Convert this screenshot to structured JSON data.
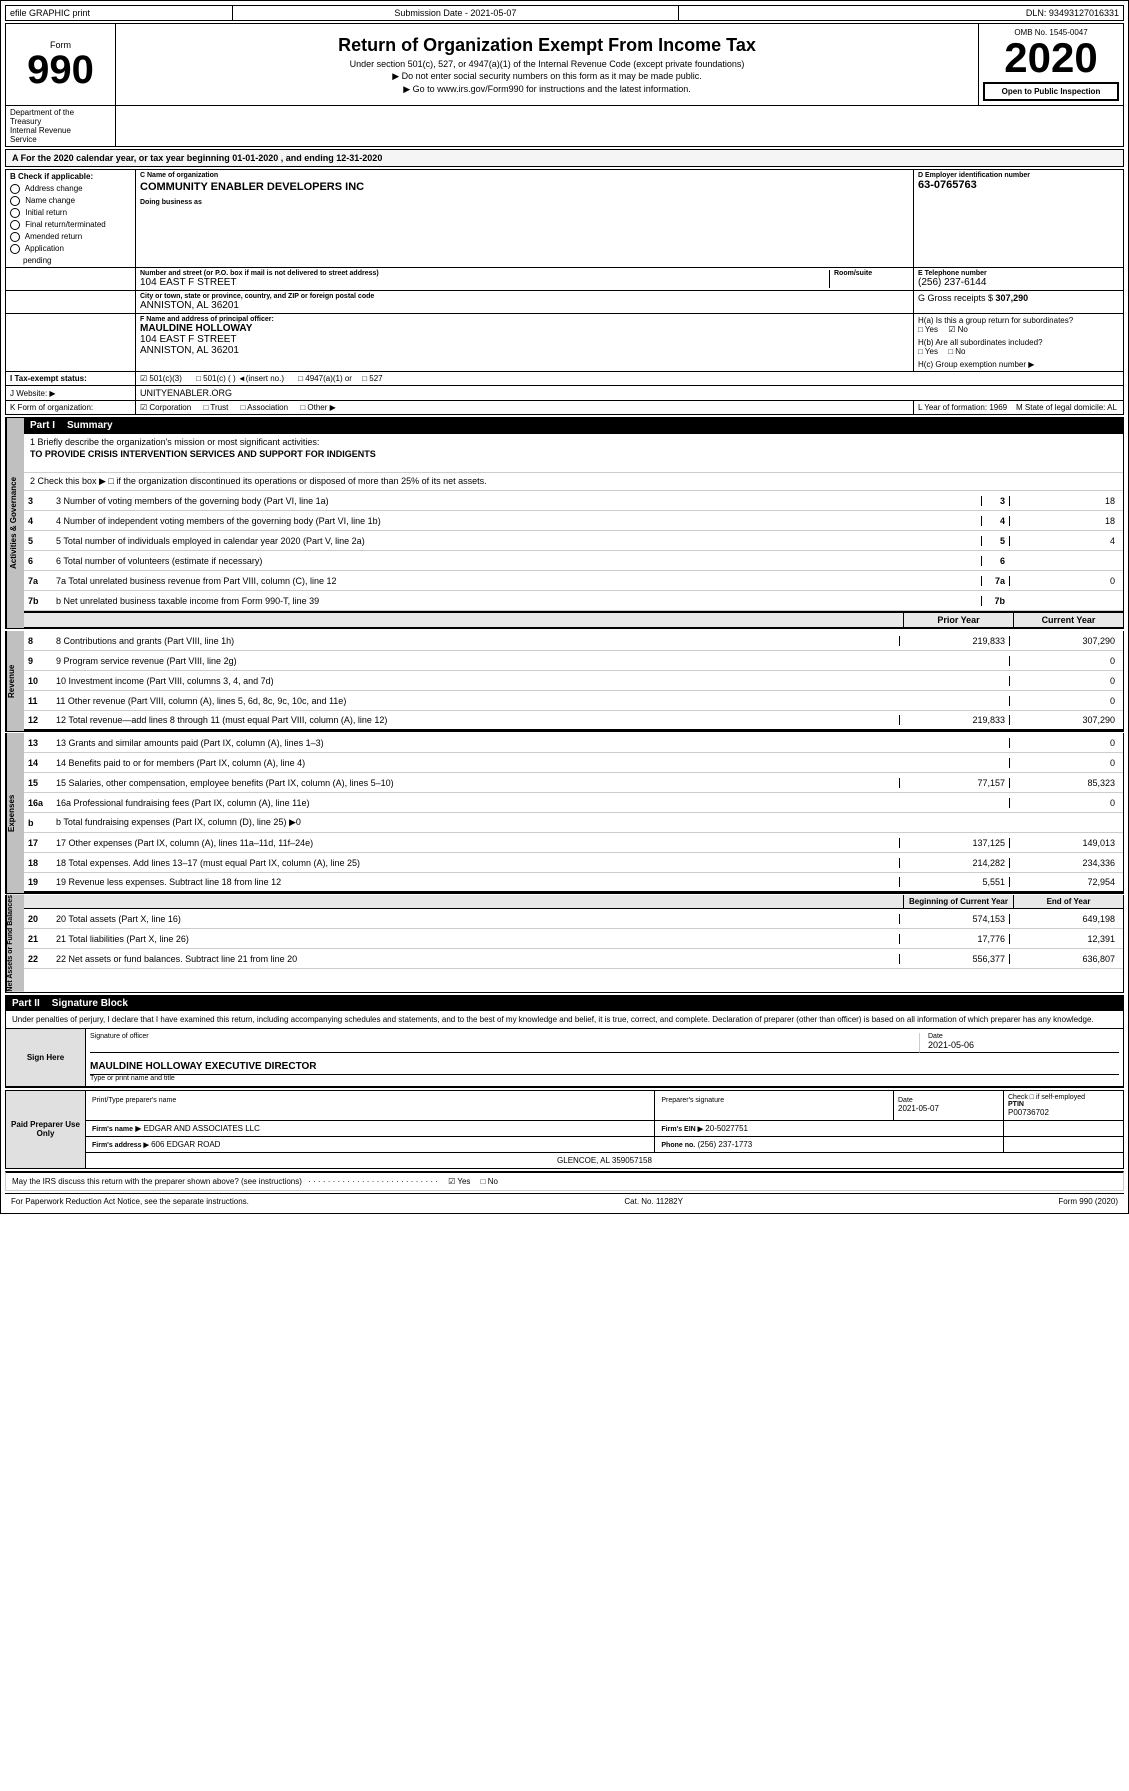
{
  "topbar": {
    "left": "efile GRAPHIC print",
    "mid": "Submission Date - 2021-05-07",
    "right": "DLN: 93493127016331"
  },
  "form": {
    "label": "Form",
    "number": "990",
    "title": "Return of Organization Exempt From Income Tax",
    "subtitle1": "Under section 501(c), 527, or 4947(a)(1) of the Internal Revenue Code (except private foundations)",
    "subtitle2": "▶ Do not enter social security numbers on this form as it may be made public.",
    "subtitle3": "▶ Go to www.irs.gov/Form990 for instructions and the latest information.",
    "omb_label": "OMB No. 1545-0047",
    "year": "2020",
    "open_public": "Open to Public Inspection"
  },
  "dept": {
    "line1": "Department of the",
    "line2": "Treasury",
    "line3": "Internal Revenue",
    "line4": "Service"
  },
  "calendar_year": {
    "text": "A   For the 2020 calendar year, or tax year beginning  01-01-2020   , and ending  12-31-2020"
  },
  "org": {
    "check_label": "B Check if applicable:",
    "address_change": "Address change",
    "name_change": "Name change",
    "initial_return": "Initial return",
    "final_return": "Final return/terminated",
    "amended_return": "Amended return",
    "application": "Application",
    "pending": "pending",
    "c_label": "C Name of organization",
    "org_name": "COMMUNITY ENABLER DEVELOPERS INC",
    "dba_label": "Doing business as",
    "dba_value": "",
    "d_label": "D Employer identification number",
    "ein": "63-0765763",
    "address_label": "Number and street (or P.O. box if mail is not delivered to street address)",
    "address_value": "104 EAST F STREET",
    "room_label": "Room/suite",
    "room_value": "",
    "phone_label": "E Telephone number",
    "phone_value": "(256) 237-6144",
    "city_label": "City or town, state or province, country, and ZIP or foreign postal code",
    "city_value": "ANNISTON, AL  36201",
    "gross_label": "G Gross receipts $",
    "gross_value": "307,290",
    "principal_label": "F Name and address of principal officer:",
    "principal_name": "MAULDINE HOLLOWAY",
    "principal_address": "104 EAST F STREET",
    "principal_city": "ANNISTON, AL  36201",
    "ha_label": "H(a) Is this a group return for subordinates?",
    "ha_yes": "Yes",
    "ha_no": "No",
    "ha_checked": "No",
    "hb_label": "H(b) Are all subordinates included?",
    "hb_yes": "Yes",
    "hb_no": "No",
    "hc_label": "H(c) Group exemption number ▶",
    "tax_label": "I   Tax-exempt status:",
    "tax_501c3": "501(c)(3)",
    "tax_501c": "501(c) (    ) ◄(insert no.)",
    "tax_4947": "4947(a)(1) or",
    "tax_527": "527",
    "website_label": "J  Website: ▶",
    "website_value": "UNITYENABLER.ORG",
    "form_label": "K Form of organization:",
    "corporation": "Corporation",
    "trust": "Trust",
    "association": "Association",
    "other": "Other ▶",
    "year_formed_label": "L Year of formation:",
    "year_formed": "1969",
    "state_label": "M State of legal domicile:",
    "state_value": "AL"
  },
  "part1": {
    "title": "Part I",
    "subtitle": "Summary",
    "line1_label": "1  Briefly describe the organization's mission or most significant activities:",
    "line1_value": "TO PROVIDE CRISIS INTERVENTION SERVICES AND SUPPORT FOR INDIGENTS",
    "line2_label": "2  Check this box ▶ □ if the organization discontinued its operations or disposed of more than 25% of its net assets.",
    "line3_label": "3  Number of voting members of the governing body (Part VI, line 1a)",
    "line3_dots": "· · · · · · · · · · ·",
    "line3_box": "3",
    "line3_value": "18",
    "line4_label": "4  Number of independent voting members of the governing body (Part VI, line 1b)",
    "line4_dots": "· · · · · · · · ·",
    "line4_box": "4",
    "line4_value": "18",
    "line5_label": "5  Total number of individuals employed in calendar year 2020 (Part V, line 2a)",
    "line5_dots": "· · · · · · · · · · ·",
    "line5_box": "5",
    "line5_value": "4",
    "line6_label": "6  Total number of volunteers (estimate if necessary)",
    "line6_dots": "· · · · · · · · · · · · · · ·",
    "line6_box": "6",
    "line6_value": "",
    "line7a_label": "7a Total unrelated business revenue from Part VIII, column (C), line 12",
    "line7a_dots": "· · · · · · · · · ·",
    "line7a_box": "7a",
    "line7a_value": "0",
    "line7b_label": "b  Net unrelated business taxable income from Form 990-T, line 39",
    "line7b_dots": "· · · · · · · · · · · ·",
    "line7b_box": "7b",
    "line7b_value": "",
    "prior_year": "Prior Year",
    "current_year": "Current Year",
    "line8_label": "8  Contributions and grants (Part VIII, line 1h)",
    "line8_dots": "· · · · · · · · · · · ·",
    "line8_prior": "219,833",
    "line8_current": "307,290",
    "line9_label": "9  Program service revenue (Part VIII, line 2g)",
    "line9_dots": "· · · · · · · · · · · · · ·",
    "line9_prior": "",
    "line9_current": "0",
    "line10_label": "10 Investment income (Part VIII, columns 3, 4, and 7d)",
    "line10_dots": "· · · · · · · ·",
    "line10_prior": "",
    "line10_current": "0",
    "line11_label": "11 Other revenue (Part VIII, column (A), lines 5, 6d, 8c, 9c, 10c, and 11e)",
    "line11_prior": "",
    "line11_current": "0",
    "line12_label": "12 Total revenue—add lines 8 through 11 (must equal Part VIII, column (A), line 12)",
    "line12_prior": "219,833",
    "line12_current": "307,290",
    "line13_label": "13 Grants and similar amounts paid (Part IX, column (A), lines 1–3)",
    "line13_dots": "· · · ·",
    "line13_prior": "",
    "line13_current": "0",
    "line14_label": "14 Benefits paid to or for members (Part IX, column (A), line 4)",
    "line14_dots": "· · · · · ·",
    "line14_prior": "",
    "line14_current": "0",
    "line15_label": "15 Salaries, other compensation, employee benefits (Part IX, column (A), lines 5–10)",
    "line15_prior": "77,157",
    "line15_current": "85,323",
    "line16a_label": "16a Professional fundraising fees (Part IX, column (A), line 11e)",
    "line16a_dots": "· · · · · ·",
    "line16a_prior": "",
    "line16a_current": "0",
    "line16b_label": "b  Total fundraising expenses (Part IX, column (D), line 25) ▶0",
    "line17_label": "17 Other expenses (Part IX, column (A), lines 11a–11d, 11f–24e)",
    "line17_dots": "· · · · · ·",
    "line17_prior": "137,125",
    "line17_current": "149,013",
    "line18_label": "18 Total expenses. Add lines 13–17 (must equal Part IX, column (A), line 25)",
    "line18_prior": "214,282",
    "line18_current": "234,336",
    "line19_label": "19 Revenue less expenses. Subtract line 18 from line 12",
    "line19_dots": "· · · · · · · · · · · · ·",
    "line19_prior": "5,551",
    "line19_current": "72,954",
    "beginning_year": "Beginning of Current Year",
    "end_year": "End of Year",
    "line20_label": "20 Total assets (Part X, line 16)",
    "line20_dots": "· · · · · · · · · · · · · · · ·",
    "line20_prior": "574,153",
    "line20_current": "649,198",
    "line21_label": "21 Total liabilities (Part X, line 26)",
    "line21_dots": "· · · · · · · · · · · · · · · ·",
    "line21_prior": "17,776",
    "line21_current": "12,391",
    "line22_label": "22 Net assets or fund balances. Subtract line 21 from line 20",
    "line22_dots": "· · · · · · · ·",
    "line22_prior": "556,377",
    "line22_current": "636,807"
  },
  "part2": {
    "title": "Part II",
    "subtitle": "Signature Block",
    "perjury_text": "Under penalties of perjury, I declare that I have examined this return, including accompanying schedules and statements, and to the best of my knowledge and belief, it is true, correct, and complete. Declaration of preparer (other than officer) is based on all information of which preparer has any knowledge.",
    "sig_label": "Signature of officer",
    "date_label": "Date",
    "date_value": "2021-05-06",
    "officer_name": "MAULDINE HOLLOWAY  EXECUTIVE DIRECTOR",
    "title_label": "Type or print name and title",
    "sign_here": "Sign Here",
    "paid_preparer": "Paid Preparer Use Only",
    "print_type_label": "Print/Type preparer's name",
    "prep_sig_label": "Preparer's signature",
    "date2_label": "Date",
    "date2_value": "2021-05-07",
    "check_label": "Check □ if self-employed",
    "ptin_label": "PTIN",
    "ptin_value": "P00736702",
    "firm_name_label": "Firm's name",
    "firm_name": "▶ EDGAR AND ASSOCIATES LLC",
    "firm_ein_label": "Firm's EIN ▶",
    "firm_ein": "20-5027751",
    "firm_address_label": "Firm's address ▶",
    "firm_address": "606 EDGAR ROAD",
    "firm_city": "GLENCOE, AL  359057158",
    "phone_label": "Phone no.",
    "phone_value": "(256) 237-1773"
  },
  "footer": {
    "may_discuss": "May the IRS discuss this return with the preparer shown above? (see instructions)",
    "dots": "· · · · · · · · · · · · · · · · · · · · · · · · · · ·",
    "yes": "Yes",
    "no": "No",
    "yes_checked": true,
    "paperwork_text": "For Paperwork Reduction Act Notice, see the separate instructions.",
    "cat_no": "Cat. No. 11282Y",
    "form_label": "Form 990 (2020)"
  }
}
